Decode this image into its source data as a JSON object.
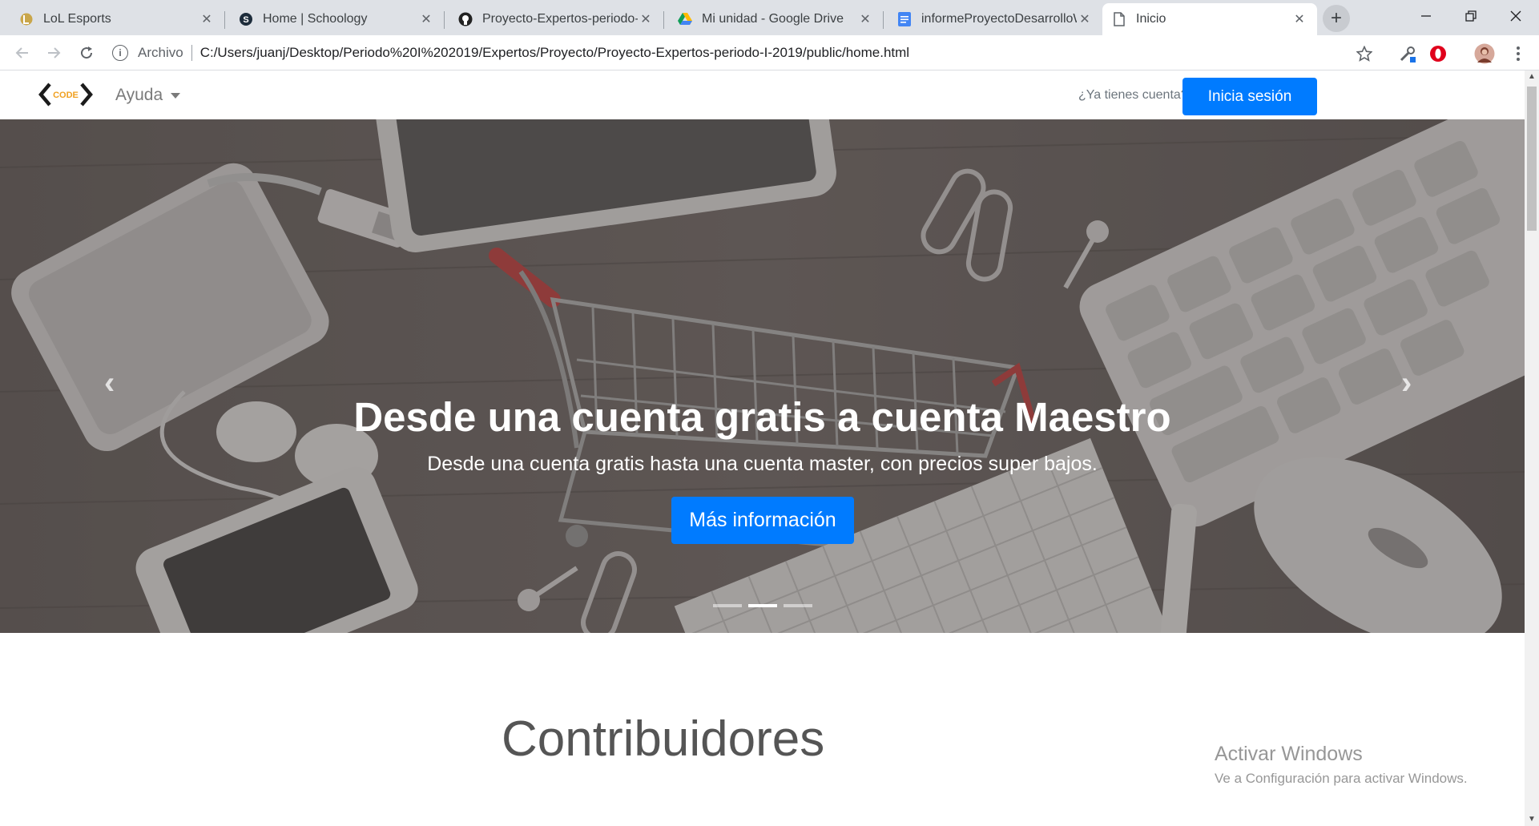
{
  "browser": {
    "tabs": [
      {
        "title": "LoL Esports",
        "icon": "lol-icon"
      },
      {
        "title": "Home | Schoology",
        "icon": "schoology-icon"
      },
      {
        "title": "Proyecto-Expertos-periodo-I",
        "icon": "github-icon"
      },
      {
        "title": "Mi unidad - Google Drive",
        "icon": "google-drive-icon"
      },
      {
        "title": "informeProyectoDesarrolloW",
        "icon": "google-docs-icon"
      },
      {
        "title": "Inicio",
        "icon": "page-icon"
      }
    ],
    "close_glyph": "✕",
    "new_tab_glyph": "+",
    "url_chip": "Archivo",
    "url": "C:/Users/juanj/Desktop/Periodo%20I%202019/Expertos/Proyecto/Proyecto-Expertos-periodo-I-2019/public/home.html"
  },
  "navbar": {
    "logo_text": "CODE",
    "menu_label": "Ayuda",
    "login_question": "¿Ya tienes cuenta?",
    "login_button": "Inicia sesión"
  },
  "carousel": {
    "title": "Desde una cuenta gratis a cuenta Maestro",
    "subtitle": "Desde una cuenta gratis hasta una cuenta master, con precios super bajos.",
    "button": "Más información",
    "prev_glyph": "‹",
    "next_glyph": "›",
    "slide_count": 3,
    "active_slide": 2
  },
  "section": {
    "title": "Contribuidores"
  },
  "watermark": {
    "line1": "Activar Windows",
    "line2": "Ve a Configuración para activar Windows."
  },
  "colors": {
    "primary": "#007bff",
    "tabstrip": "#dee1e6"
  }
}
